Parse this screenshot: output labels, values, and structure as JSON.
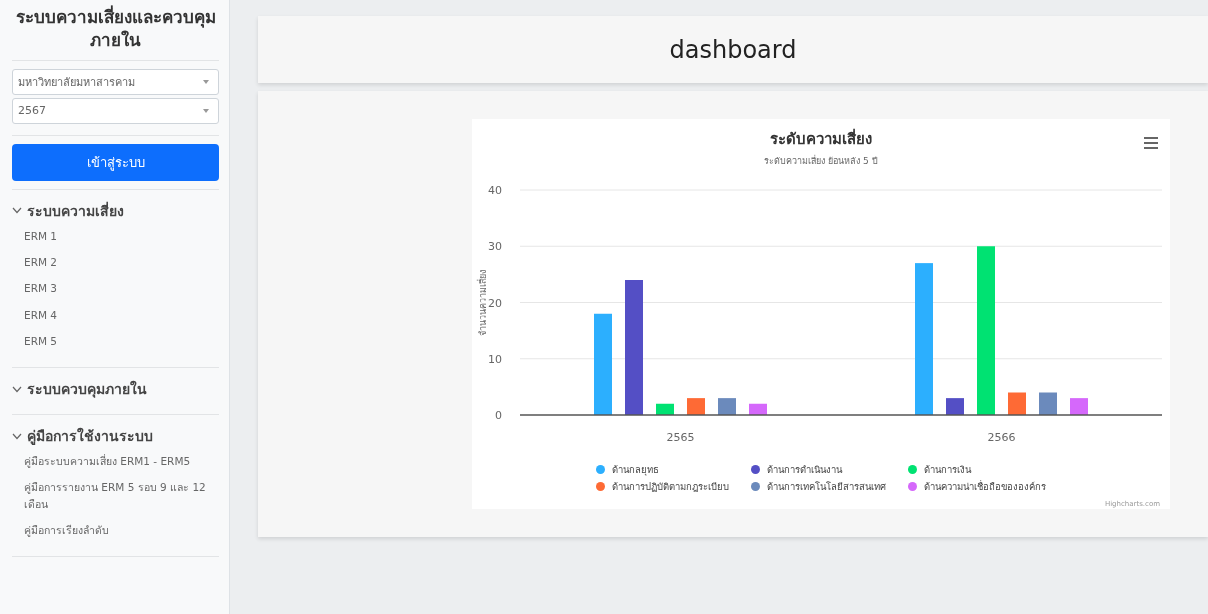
{
  "sidebar": {
    "title": "ระบบความเสี่ยงและควบคุม ภายใน",
    "selects": [
      {
        "value": "มหาวิทยาลัยมหาสารคาม"
      },
      {
        "value": "2567"
      }
    ],
    "login_button": "เข้าสู่ระบบ",
    "sections": [
      {
        "label": "ระบบความเสี่ยง",
        "items": [
          "ERM 1",
          "ERM 2",
          "ERM 3",
          "ERM 4",
          "ERM 5"
        ]
      },
      {
        "label": "ระบบควบคุมภายใน"
      },
      {
        "label": "คู่มือการใช้งานระบบ",
        "items": [
          "คู่มือระบบความเสี่ยง ERM1 - ERM5",
          "คู่มือการรายงาน ERM 5 รอบ 9 และ 12 เดือน",
          "คู่มือการเรียงลำดับ"
        ]
      }
    ]
  },
  "header": {
    "title": "dashboard"
  },
  "chart": {
    "credits": "Highcharts.com",
    "chart_data": {
      "type": "bar",
      "title": "ระดับความเสี่ยง",
      "subtitle": "ระดับความเสี่ยง ย้อนหลัง 5 ปี",
      "ylabel": "จำนวนความเสี่ยง",
      "categories": [
        "2565",
        "2566"
      ],
      "ylim": [
        0,
        40
      ],
      "grid": true,
      "legend": true,
      "yticks": [
        0,
        10,
        20,
        30,
        40
      ],
      "series": [
        {
          "name": "ด้านกลยุทธ",
          "color": "#2caffe",
          "values": [
            18,
            27
          ]
        },
        {
          "name": "ด้านการดำเนินงาน",
          "color": "#544fc5",
          "values": [
            24,
            3
          ]
        },
        {
          "name": "ด้านการเงิน",
          "color": "#00e272",
          "values": [
            2,
            30
          ]
        },
        {
          "name": "ด้านการปฏิบัติตามกฎระเบียบ",
          "color": "#fe6a35",
          "values": [
            3,
            4
          ]
        },
        {
          "name": "ด้านการเทคโนโลยีสารสนเทศ",
          "color": "#6b8abc",
          "values": [
            3,
            4
          ]
        },
        {
          "name": "ด้านความน่าเชื่อถือขององค์กร",
          "color": "#d568fb",
          "values": [
            2,
            3
          ]
        }
      ]
    }
  }
}
